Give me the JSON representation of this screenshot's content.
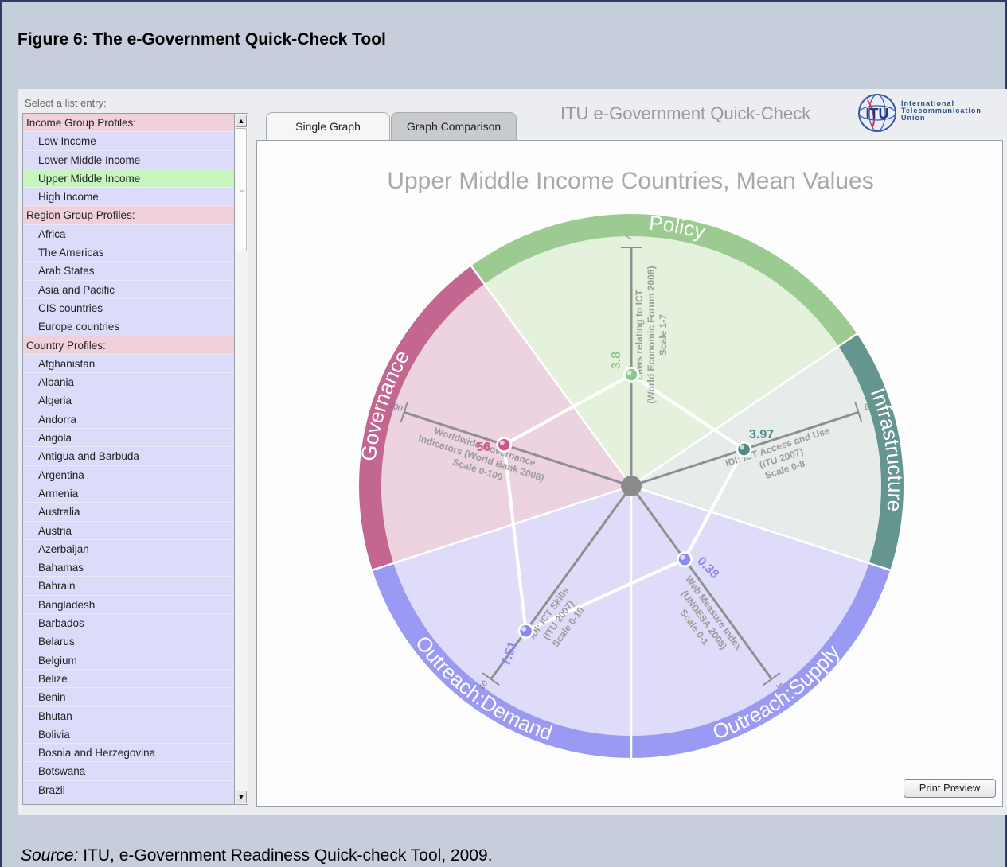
{
  "figure_title": "Figure 6: The e-Government Quick-Check Tool",
  "source": {
    "label": "Source:",
    "text": " ITU, e-Government Readiness Quick-check Tool, 2009."
  },
  "sidebar": {
    "select_label": "Select a list entry:",
    "items": [
      {
        "label": "Income Group Profiles:",
        "kind": "header"
      },
      {
        "label": "Low Income",
        "kind": "item"
      },
      {
        "label": "Lower Middle Income",
        "kind": "item"
      },
      {
        "label": "Upper Middle Income",
        "kind": "item",
        "selected": true
      },
      {
        "label": "High Income",
        "kind": "item"
      },
      {
        "label": "Region Group Profiles:",
        "kind": "header"
      },
      {
        "label": "Africa",
        "kind": "item"
      },
      {
        "label": "The Americas",
        "kind": "item"
      },
      {
        "label": "Arab States",
        "kind": "item"
      },
      {
        "label": "Asia and Pacific",
        "kind": "item"
      },
      {
        "label": "CIS countries",
        "kind": "item"
      },
      {
        "label": "Europe countries",
        "kind": "item"
      },
      {
        "label": "Country Profiles:",
        "kind": "header"
      },
      {
        "label": "Afghanistan",
        "kind": "item"
      },
      {
        "label": "Albania",
        "kind": "item"
      },
      {
        "label": "Algeria",
        "kind": "item"
      },
      {
        "label": "Andorra",
        "kind": "item"
      },
      {
        "label": "Angola",
        "kind": "item"
      },
      {
        "label": "Antigua and Barbuda",
        "kind": "item"
      },
      {
        "label": "Argentina",
        "kind": "item"
      },
      {
        "label": "Armenia",
        "kind": "item"
      },
      {
        "label": "Australia",
        "kind": "item"
      },
      {
        "label": "Austria",
        "kind": "item"
      },
      {
        "label": "Azerbaijan",
        "kind": "item"
      },
      {
        "label": "Bahamas",
        "kind": "item"
      },
      {
        "label": "Bahrain",
        "kind": "item"
      },
      {
        "label": "Bangladesh",
        "kind": "item"
      },
      {
        "label": "Barbados",
        "kind": "item"
      },
      {
        "label": "Belarus",
        "kind": "item"
      },
      {
        "label": "Belgium",
        "kind": "item"
      },
      {
        "label": "Belize",
        "kind": "item"
      },
      {
        "label": "Benin",
        "kind": "item"
      },
      {
        "label": "Bhutan",
        "kind": "item"
      },
      {
        "label": "Bolivia",
        "kind": "item"
      },
      {
        "label": "Bosnia and Herzegovina",
        "kind": "item"
      },
      {
        "label": "Botswana",
        "kind": "item"
      },
      {
        "label": "Brazil",
        "kind": "item"
      }
    ]
  },
  "tabs": [
    {
      "label": "Single Graph",
      "active": true
    },
    {
      "label": "Graph Comparison",
      "active": false
    }
  ],
  "app_title": "ITU e-Government Quick-Check",
  "logo": {
    "mark": "ITU",
    "lines": [
      "International",
      "Telecommunication",
      "Union"
    ]
  },
  "print_button": "Print Preview",
  "colors": {
    "policy": "#9ccb91",
    "infrastructure": "#64958f",
    "supply": "#9a9af4",
    "demand": "#9a9af4",
    "governance": "#c36690"
  },
  "chart_data": {
    "type": "radar",
    "title": "Upper Middle Income Countries, Mean Values",
    "sectors": [
      "Policy",
      "Infrastructure",
      "Outreach:Supply",
      "Outreach:Demand",
      "Governance"
    ],
    "axes": [
      {
        "sector": "Policy",
        "lines": [
          "Laws relating to ICT",
          "(World Economic Forum 2008)",
          "Scale 1-7"
        ],
        "scale_max_label": "7",
        "min": 1,
        "max": 7,
        "value": 3.8,
        "value_label": "3.8",
        "color": "#8cc98c"
      },
      {
        "sector": "Infrastructure",
        "lines": [
          "IDI: ICT Access and Use",
          "(ITU 2007)",
          "Scale 0-8"
        ],
        "scale_max_label": "8",
        "min": 0,
        "max": 8,
        "value": 3.97,
        "value_label": "3.97",
        "color": "#4f8a86"
      },
      {
        "sector": "Outreach:Supply",
        "lines": [
          "Web Measure Index",
          "(UNDESA 2008)",
          "Scale 0-1"
        ],
        "scale_max_label": "1",
        "min": 0,
        "max": 1,
        "value": 0.38,
        "value_label": "0.38",
        "color": "#8a8af0"
      },
      {
        "sector": "Outreach:Demand",
        "lines": [
          "IDI: ICT Skills",
          "(ITU 2007)",
          "Scale 0-10"
        ],
        "scale_max_label": "10",
        "min": 0,
        "max": 10,
        "value": 7.51,
        "value_label": "7.51",
        "color": "#8a8af0"
      },
      {
        "sector": "Governance",
        "lines": [
          "Worldwide Governance",
          "Indicators (World Bank 2008)",
          "Scale 0-100"
        ],
        "scale_max_label": "100",
        "min": 0,
        "max": 100,
        "value": 56,
        "value_label": "56",
        "color": "#d0558f"
      }
    ]
  }
}
